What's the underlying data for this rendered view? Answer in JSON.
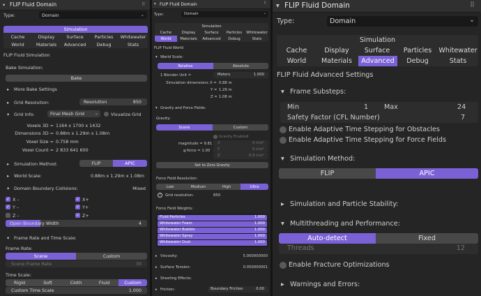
{
  "p1": {
    "title": "FLIP Fluid Domain",
    "type_label": "Type:",
    "type_value": "Domain",
    "tabs": [
      "Simulation",
      "Cache",
      "Display",
      "Surface",
      "Particles",
      "Whitewater",
      "World",
      "Materials",
      "Advanced",
      "Debug",
      "Stats"
    ],
    "section_title": "FLIP Fluid Simulation",
    "bake_simulation": "Bake Simulation:",
    "bake_button": "Bake",
    "more_bake": "More Bake Settings",
    "grid_resolution_label": "Grid Resolution:",
    "resolution_label": "Resolution",
    "resolution_value": "850",
    "grid_info": "Grid Info:",
    "grid_mode": "Final Mesh Grid",
    "visualize_grid": "Visualize Grid",
    "voxels_3d_label": "Voxels 3D =",
    "voxels_3d": "1164  x  1700  x  1432",
    "dimensions_3d_label": "Dimensions 3D =",
    "dimensions_3d": "0.88m  x  1.29m  x  1.08m",
    "voxel_size_label": "Voxel Size =",
    "voxel_size": "0.758 mm",
    "voxel_count_label": "Voxel Count =",
    "voxel_count": "2 833 641 600",
    "simulation_method": "Simulation Method:",
    "flip": "FLIP",
    "apic": "APIC",
    "world_scale": "World Scale:",
    "world_scale_value": "0.88m  x  1.29m  x  1.08m",
    "boundary": "Domain Boundary Collisions:",
    "boundary_mode": "Mixed",
    "x_minus": "X –",
    "x_plus": "X+",
    "y_minus": "Y –",
    "y_plus": "Y+",
    "z_minus": "Z –",
    "z_plus": "Z+",
    "open_boundary": "Open Boundary Width",
    "open_boundary_value": "4",
    "frame_rate_time": "Frame Rate and Time Scale:",
    "frame_rate": "Frame Rate:",
    "scene": "Scene",
    "custom": "Custom",
    "scene_frame_rate": "Scene Frame Rate",
    "scene_frame_rate_value": "30",
    "time_scale": "Time Scale:",
    "time_opts": [
      "Rigid",
      "Soft",
      "Cloth",
      "Fluid",
      "Custom"
    ],
    "custom_time_scale": "Custom Time Scale",
    "custom_time_scale_value": "1.000"
  },
  "p2": {
    "title": "FLIP Fluid Domain",
    "type_label": "Type:",
    "type_value": "Domain",
    "tabs": [
      "Simulation",
      "Cache",
      "Display",
      "Surface",
      "Particles",
      "Whitewater",
      "World",
      "Materials",
      "Advanced",
      "Debug",
      "Stats"
    ],
    "section_title": "FLIP Fluid World",
    "world_scale": "World Scale:",
    "relative": "Relative",
    "absolute": "Absolute",
    "blender_unit": "1 Blender Unit =",
    "meters": "Meters",
    "meters_value": "1.000",
    "sim_dims": "Simulation dimensions:",
    "x_label": "X =",
    "x_value": "0.88 m",
    "y_label": "Y =",
    "y_value": "1.29 m",
    "z_label": "Z =",
    "z_value": "1.08 m",
    "gravity_force": "Gravity and Force Fields:",
    "gravity": "Gravity:",
    "scene": "Scene",
    "custom": "Custom",
    "gravity_enabled": "Gravity Enabled",
    "magnitude": "magnitude = 9.81",
    "g_force": "g-force = 1.00",
    "gx_label": "X",
    "gx_value": "0 m/s²",
    "gy_label": "Y",
    "gy_value": "0 m/s²",
    "gz_label": "Z",
    "gz_value": "-9.8 m/s²",
    "zero_gravity": "Set to Zero Gravity",
    "ff_resolution": "Force Field Resolution:",
    "ff_opts": [
      "Low",
      "Medium",
      "High",
      "Ultra"
    ],
    "grid_res": "Grid resolution:",
    "grid_res_value": "850",
    "ff_weights": "Force Field Weights:",
    "weights": [
      {
        "name": "Fluid Particles",
        "value": "1.000"
      },
      {
        "name": "Whitewater Foam",
        "value": "1.000"
      },
      {
        "name": "Whitewater Bubble",
        "value": "1.000"
      },
      {
        "name": "Whitewater Spray",
        "value": "1.000"
      },
      {
        "name": "Whitewater Dust",
        "value": "1.000"
      }
    ],
    "viscosity": "Viscosity:",
    "viscosity_value": "5.000000000",
    "surface_tension": "Surface Tension:",
    "surface_tension_value": "0.050000001",
    "sheeting": "Sheeting Effects:",
    "friction": "Friction:",
    "boundary_friction": "Boundary Friction",
    "boundary_friction_value": "0.00"
  },
  "p3": {
    "title": "FLIP Fluid Domain",
    "type_label": "Type:",
    "type_value": "Domain",
    "tabs": [
      "Simulation",
      "Cache",
      "Display",
      "Surface",
      "Particles",
      "Whitewater",
      "World",
      "Materials",
      "Advanced",
      "Debug",
      "Stats"
    ],
    "section_title": "FLIP Fluid Advanced Settings",
    "frame_substeps": "Frame Substeps:",
    "min_label": "Min",
    "min_value": "1",
    "max_label": "Max",
    "max_value": "24",
    "cfl_label": "Safety Factor (CFL Number)",
    "cfl_value": "7",
    "adaptive_obstacles": "Enable Adaptive Time Stepping for Obstacles",
    "adaptive_force": "Enable Adaptive Time Stepping for Force Fields",
    "simulation_method": "Simulation Method:",
    "flip": "FLIP",
    "apic": "APIC",
    "stability": "Simulation and Particle Stability:",
    "multithreading": "Multithreading and Performance:",
    "auto_detect": "Auto-detect",
    "fixed": "Fixed",
    "threads_label": "Threads",
    "threads_value": "12",
    "fracture": "Enable Fracture Optimizations",
    "warnings": "Warnings and Errors:"
  },
  "colors": {
    "accent": "#7b61d6",
    "panel": "#252525",
    "field": "#3c3c3c"
  }
}
